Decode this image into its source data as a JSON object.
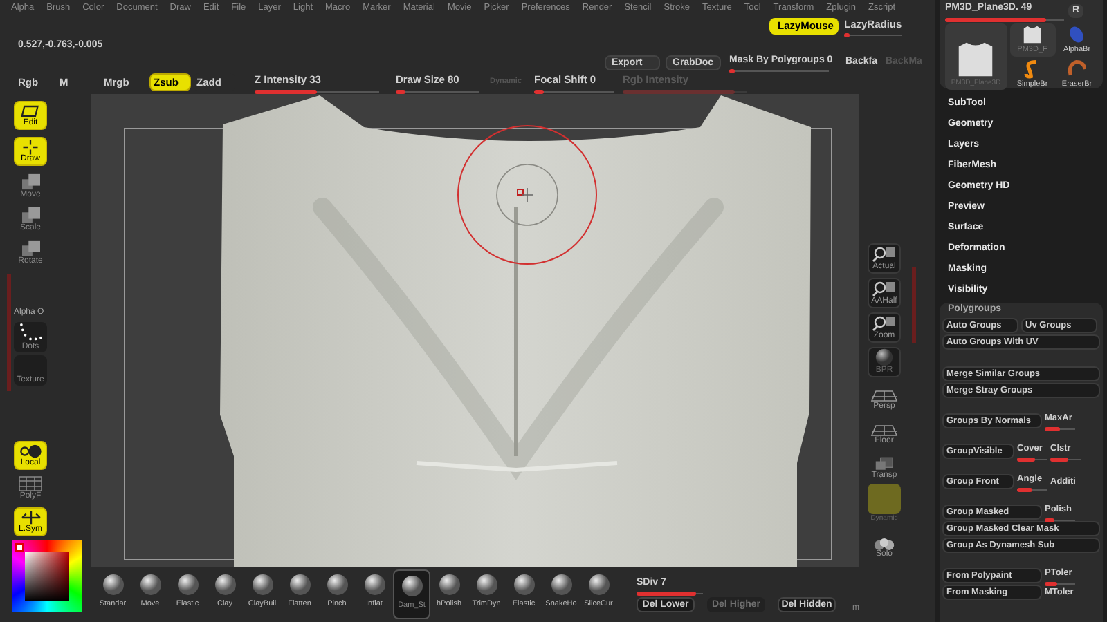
{
  "menu": [
    "Alpha",
    "Brush",
    "Color",
    "Document",
    "Draw",
    "Edit",
    "File",
    "Layer",
    "Light",
    "Macro",
    "Marker",
    "Material",
    "Movie",
    "Picker",
    "Preferences",
    "Render",
    "Stencil",
    "Stroke",
    "Texture",
    "Tool",
    "Transform",
    "Zplugin",
    "Zscript"
  ],
  "lazy_mouse": {
    "label": "LazyMouse",
    "on": true
  },
  "lazy_radius": {
    "label": "LazyRadius",
    "level": 0.1
  },
  "coordinates": "0.527,-0.763,-0.005",
  "document_buttons": [
    "Export",
    "GrabDoc"
  ],
  "mask_slider": {
    "label": "Mask By Polygroups",
    "value": "0",
    "level": 0.05
  },
  "backface_labels": [
    {
      "label": "Backfa",
      "disabled": false
    },
    {
      "label": "BackMa",
      "disabled": true
    }
  ],
  "color_modes": [
    {
      "label": "Rgb",
      "selected": false
    },
    {
      "label": "M",
      "selected": false
    },
    {
      "label": "Mrgb",
      "selected": false
    }
  ],
  "sculpt_modes": [
    {
      "label": "Zsub",
      "selected": true
    },
    {
      "label": "Zadd",
      "selected": false
    }
  ],
  "sliders": [
    {
      "kind": "slider",
      "label": "Z Intensity",
      "value": "33",
      "level": 0.5,
      "disabled": false
    },
    {
      "kind": "slider",
      "label": "Draw Size",
      "value": "80",
      "level": 0.12,
      "disabled": false
    },
    {
      "kind": "toggle",
      "label": "Dynamic",
      "disabled": true
    },
    {
      "kind": "slider",
      "label": "Focal Shift",
      "value": "0",
      "level": 0.12,
      "disabled": false
    },
    {
      "kind": "slider",
      "label": "Rgb Intensity",
      "level": 0.9,
      "disabled": true
    }
  ],
  "tool": {
    "name": "PM3D_Plane3D. 49",
    "level": 0.85,
    "r_label": "R",
    "current": "PM3D_Plane3D",
    "thumbnails": [
      {
        "label": "PM3D_F",
        "kind": "mesh"
      },
      {
        "label": "AlphaBr",
        "kind": "gem"
      },
      {
        "label": "SimpleBr",
        "kind": "s-brush"
      },
      {
        "label": "EraserBr",
        "kind": "eraser"
      }
    ]
  },
  "left_shelf": [
    {
      "kind": "edit",
      "label": "Edit",
      "on": true
    },
    {
      "kind": "draw",
      "label": "Draw",
      "on": true
    },
    {
      "kind": "move",
      "label": "Move",
      "on": false
    },
    {
      "kind": "scale",
      "label": "Scale",
      "on": false
    },
    {
      "kind": "rotate",
      "label": "Rotate",
      "on": false
    }
  ],
  "alpha_label": "Alpha O",
  "alpha_slots": [
    {
      "kind": "dots",
      "label": "Dots"
    },
    {
      "kind": "texture",
      "label": "Texture"
    }
  ],
  "left_shelf_bottom": [
    {
      "kind": "local",
      "label": "Local",
      "on": true
    },
    {
      "kind": "polyf",
      "label": "PolyF",
      "on": false
    },
    {
      "kind": "lsym",
      "label": "L.Sym",
      "on": true
    }
  ],
  "right_shelf": [
    {
      "kind": "actual",
      "label": "Actual"
    },
    {
      "kind": "aahalf",
      "label": "AAHalf"
    },
    {
      "kind": "zoom",
      "label": "Zoom"
    },
    {
      "kind": "bpr",
      "label": "BPR"
    },
    {
      "kind": "persp",
      "label": "Persp"
    },
    {
      "kind": "floor",
      "label": "Floor"
    },
    {
      "kind": "transp",
      "label": "Transp"
    },
    {
      "kind": "dynamic",
      "label": "Dynamic"
    },
    {
      "kind": "solo",
      "label": "Solo"
    }
  ],
  "palette_menu": [
    "SubTool",
    "Geometry",
    "Layers",
    "FiberMesh",
    "Geometry HD",
    "Preview",
    "Surface",
    "Deformation",
    "Masking",
    "Visibility"
  ],
  "polygroups": {
    "title": "Polygroups",
    "sections": [
      [
        [
          {
            "kind": "button",
            "label": "Auto Groups"
          },
          {
            "kind": "button",
            "label": "Uv Groups"
          }
        ],
        [
          {
            "kind": "button",
            "label": "Auto Groups With UV"
          }
        ]
      ],
      [
        [
          {
            "kind": "button",
            "label": "Merge Similar Groups"
          }
        ],
        [
          {
            "kind": "button",
            "label": "Merge Stray Groups"
          }
        ]
      ],
      [
        [
          {
            "kind": "button",
            "label": "Groups By Normals"
          },
          {
            "kind": "slider",
            "label": "MaxAr",
            "level": 0.5
          }
        ]
      ],
      [
        [
          {
            "kind": "button",
            "label": "GroupVisible"
          },
          {
            "kind": "slider",
            "label": "Cover",
            "level": 0.6
          },
          {
            "kind": "slider",
            "label": "Clstr",
            "level": 0.6
          }
        ]
      ],
      [
        [
          {
            "kind": "button",
            "label": "Group Front"
          },
          {
            "kind": "slider",
            "label": "Angle",
            "level": 0.5
          },
          {
            "kind": "text",
            "label": "Additi"
          }
        ]
      ],
      [
        [
          {
            "kind": "button",
            "label": "Group Masked"
          },
          {
            "kind": "slider",
            "label": "Polish",
            "level": 0.3
          }
        ],
        [
          {
            "kind": "button",
            "label": "Group Masked Clear Mask"
          }
        ],
        [
          {
            "kind": "button",
            "label": "Group As Dynamesh Sub"
          }
        ]
      ],
      [
        [
          {
            "kind": "button",
            "label": "From Polypaint"
          },
          {
            "kind": "slider",
            "label": "PToler",
            "level": 0.4
          }
        ],
        [
          {
            "kind": "button",
            "label": "From Masking"
          },
          {
            "kind": "text",
            "label": "MToler"
          }
        ]
      ]
    ]
  },
  "brushes": [
    {
      "label": "Standar",
      "selected": false
    },
    {
      "label": "Move",
      "selected": false
    },
    {
      "label": "Elastic",
      "selected": false
    },
    {
      "label": "Clay",
      "selected": false
    },
    {
      "label": "ClayBuil",
      "selected": false
    },
    {
      "label": "Flatten",
      "selected": false
    },
    {
      "label": "Pinch",
      "selected": false
    },
    {
      "label": "Inflat",
      "selected": false
    },
    {
      "label": "Dam_St",
      "selected": true
    },
    {
      "label": "hPolish",
      "selected": false
    },
    {
      "label": "TrimDyn",
      "selected": false
    },
    {
      "label": "Elastic",
      "selected": false
    },
    {
      "label": "SnakeHo",
      "selected": false
    },
    {
      "label": "SliceCur",
      "selected": false
    }
  ],
  "subdivision": {
    "label": "SDiv",
    "value": "7",
    "level": 0.9
  },
  "subdiv_buttons": [
    {
      "label": "Del Lower",
      "disabled": false
    },
    {
      "label": "Del Higher",
      "disabled": true
    },
    {
      "label": "Del Hidden",
      "disabled": false
    }
  ],
  "material_label": "m"
}
